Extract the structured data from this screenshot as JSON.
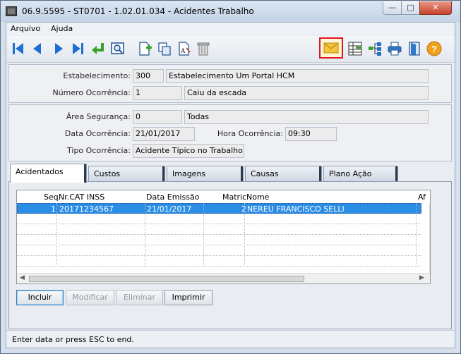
{
  "window": {
    "title": "06.9.5595 - ST0701 - 1.02.01.034 - Acidentes Trabalho"
  },
  "menu": {
    "items": [
      "Arquivo",
      "Ajuda"
    ]
  },
  "toolbar": {
    "icons": [
      "first-record-icon",
      "previous-record-icon",
      "next-record-icon",
      "last-record-icon",
      "return-icon",
      "search-icon",
      "new-record-icon",
      "copy-icon",
      "edit-text-icon",
      "delete-icon",
      "email-icon",
      "spreadsheet-icon",
      "hierarchy-icon",
      "print-icon",
      "exit-icon",
      "help-icon"
    ],
    "accent_color": "#1f6fd1",
    "highlight_color": "#e0161e"
  },
  "header": {
    "estabelecimento_label": "Estabelecimento:",
    "estabelecimento_code": "300",
    "estabelecimento_name": "Estabelecimento Um Portal HCM",
    "ocorrencia_label": "Número Ocorrência:",
    "ocorrencia_code": "1",
    "ocorrencia_desc": "Caiu da escada"
  },
  "details": {
    "area_label": "Área Segurança:",
    "area_code": "0",
    "area_desc": "Todas",
    "data_label": "Data Ocorrência:",
    "data_value": "21/01/2017",
    "hora_label": "Hora Ocorrência:",
    "hora_value": "09:30",
    "tipo_label": "Tipo Ocorrência:",
    "tipo_value": "Acidente Típico no Trabalho"
  },
  "tabs": [
    "Acidentados",
    "Custos",
    "Imagens",
    "Causas",
    "Plano Ação"
  ],
  "grid": {
    "columns": [
      "Seq",
      "Nr.CAT INSS",
      "Data Emissão",
      "Matric",
      "Nome",
      "Af"
    ],
    "rows": [
      {
        "seq": "1",
        "cat": "20171234567",
        "data": "21/01/2017",
        "matric": "2",
        "nome": "NEREU FRANCISCO SELLI"
      }
    ]
  },
  "buttons": {
    "incluir": "Incluir",
    "modificar": "Modificar",
    "eliminar": "Eliminar",
    "imprimir": "Imprimir"
  },
  "status": {
    "text": "Enter data or press ESC to end."
  }
}
